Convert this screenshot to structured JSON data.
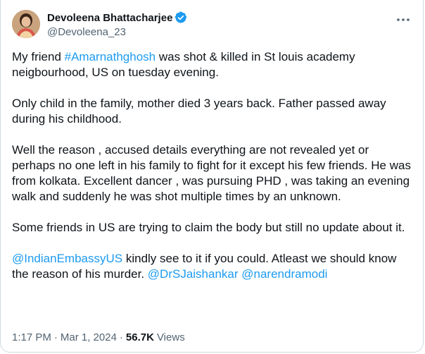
{
  "author": {
    "display_name": "Devoleena Bhattacharjee",
    "handle": "@Devoleena_23",
    "verified_color": "#1d9bf0"
  },
  "more_icon": "more-horizontal-icon",
  "tweet": {
    "p1": {
      "pre": "My friend ",
      "hashtag": "#Amarnathghosh",
      "post": " was shot & killed in St louis academy neigbourhood, US on tuesday evening."
    },
    "p2": "Only child in the family, mother died 3 years back. Father passed away during his childhood.",
    "p3": "Well the reason , accused details everything are not revealed yet or perhaps no one left in his family to fight for it except his few friends. He was from kolkata. Excellent dancer , was pursuing PHD , was taking an evening walk and suddenly he was shot multiple times by an unknown.",
    "p4": "Some friends in US are trying to claim the body but still no update about it.",
    "p5": {
      "mention1": "@IndianEmbassyUS",
      "text1": " kindly see to it if you could. Atleast we should know the reason of his murder. ",
      "mention2": "@DrSJaishankar",
      "space": " ",
      "mention3": "@narendramodi"
    }
  },
  "meta": {
    "time": "1:17 PM",
    "sep1": "·",
    "date": "Mar 1, 2024",
    "sep2": "·",
    "views_count": "56.7K",
    "views_label": "Views"
  },
  "colors": {
    "link": "#1d9bf0",
    "text": "#0f1419",
    "secondary": "#536471"
  }
}
